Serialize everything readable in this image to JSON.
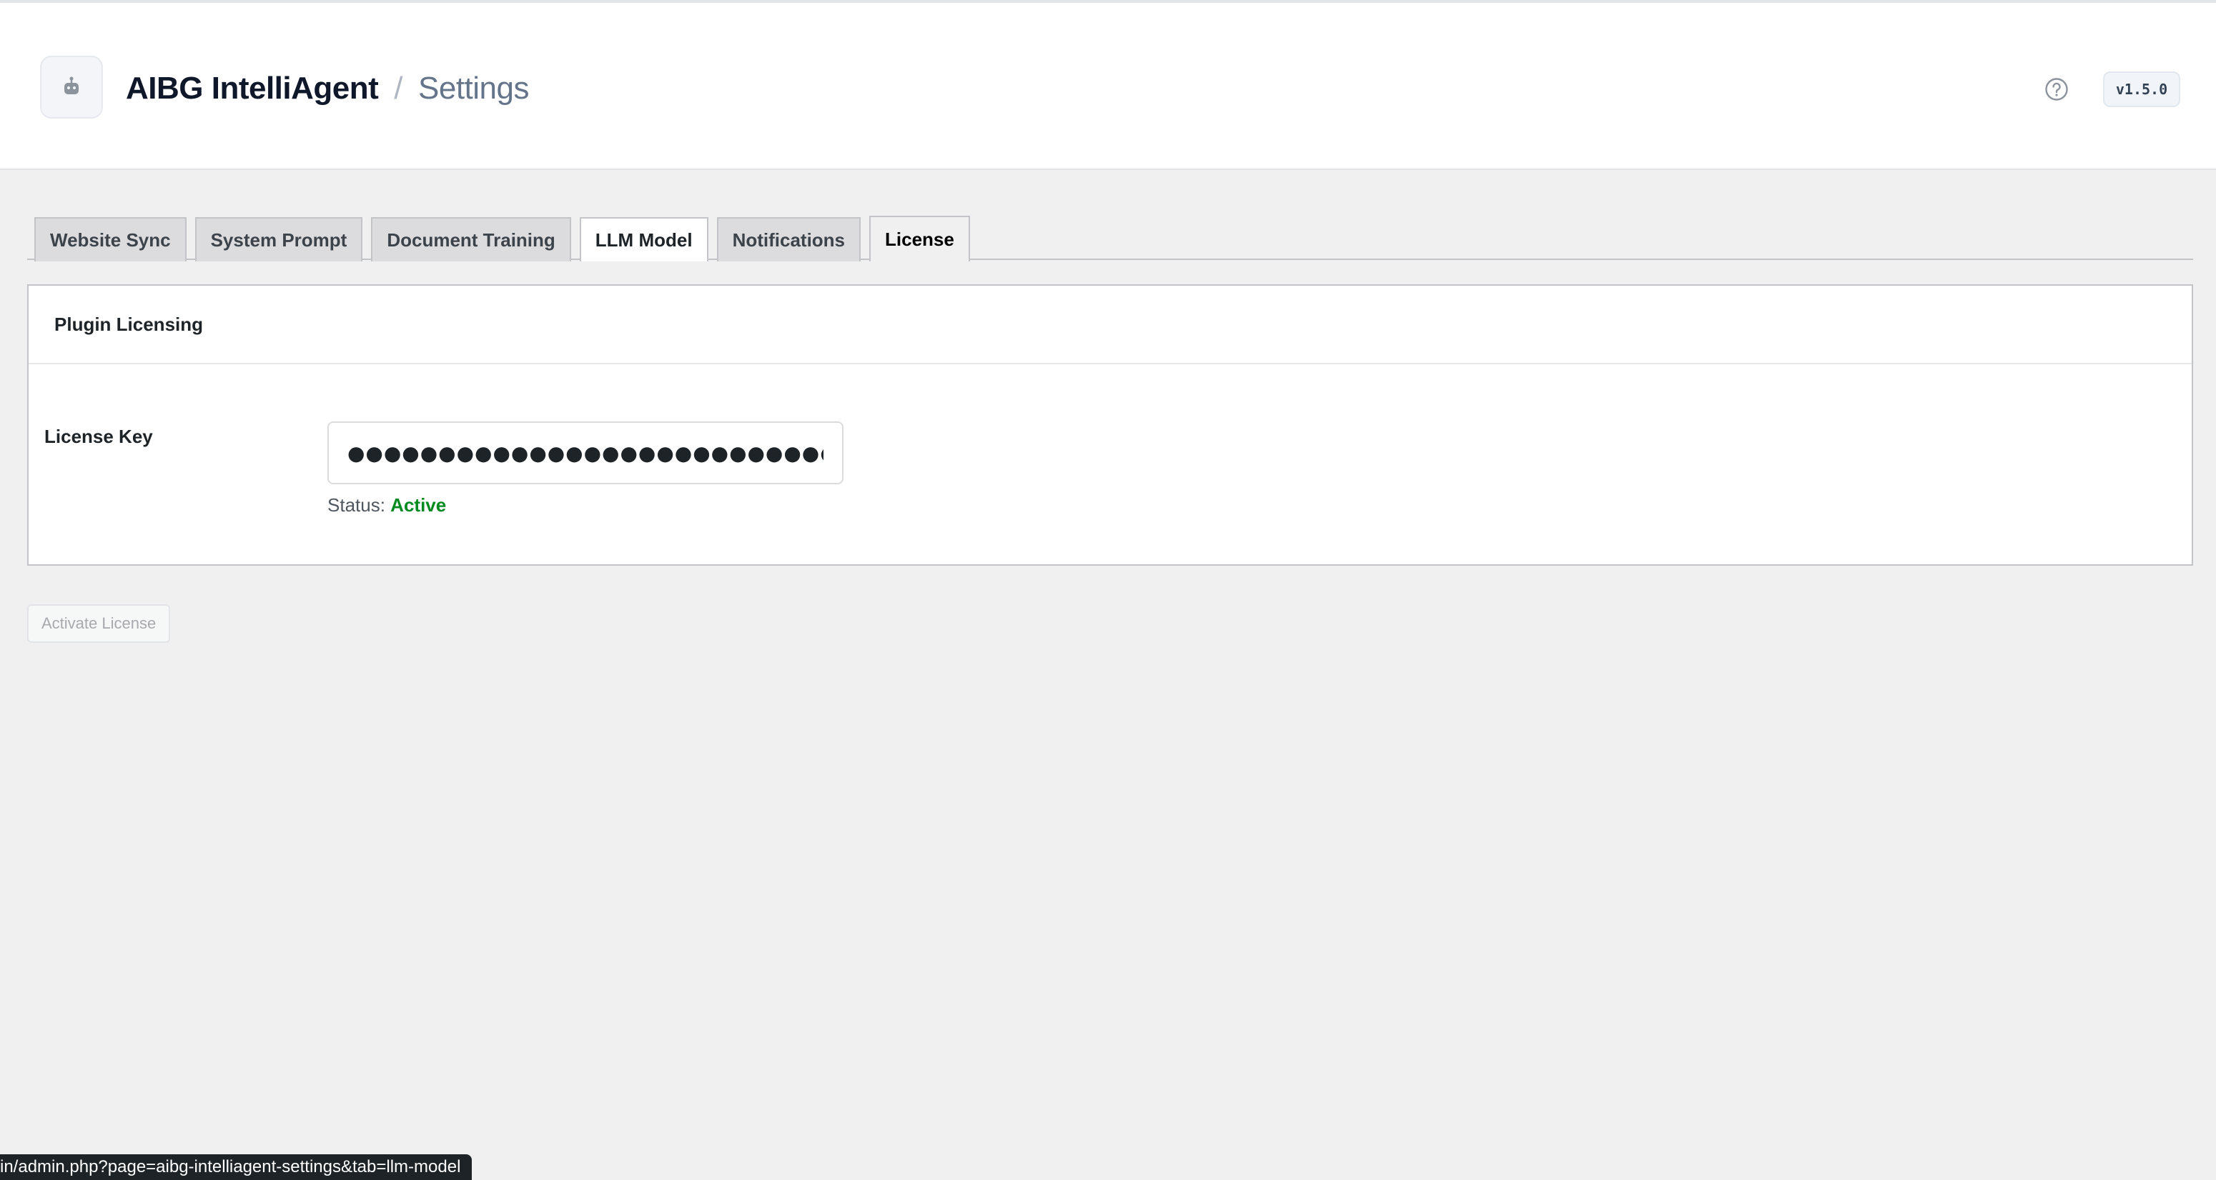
{
  "header": {
    "app_name": "AIBG IntelliAgent",
    "separator": "/",
    "page_title": "Settings",
    "version": "v1.5.0"
  },
  "tabs": [
    {
      "label": "Website Sync",
      "active": false
    },
    {
      "label": "System Prompt",
      "active": false
    },
    {
      "label": "Document Training",
      "active": false
    },
    {
      "label": "LLM Model",
      "active": false,
      "hovered": true
    },
    {
      "label": "Notifications",
      "active": false
    },
    {
      "label": "License",
      "active": true
    }
  ],
  "license_panel": {
    "title": "Plugin Licensing",
    "field_label": "License Key",
    "license_key_value": "●●●●●●●●●●●●●●●●●●●●●●●●●●●●●●●●●●●●●●",
    "status_label": "Status:",
    "status_value": "Active",
    "status_color": "#008a20"
  },
  "actions": {
    "activate_label": "Activate License"
  },
  "browser_status": {
    "url": "in/admin.php?page=aibg-intelliagent-settings&tab=llm-model"
  },
  "icons": {
    "logo": "robot-icon",
    "help": "help-circle-icon"
  }
}
